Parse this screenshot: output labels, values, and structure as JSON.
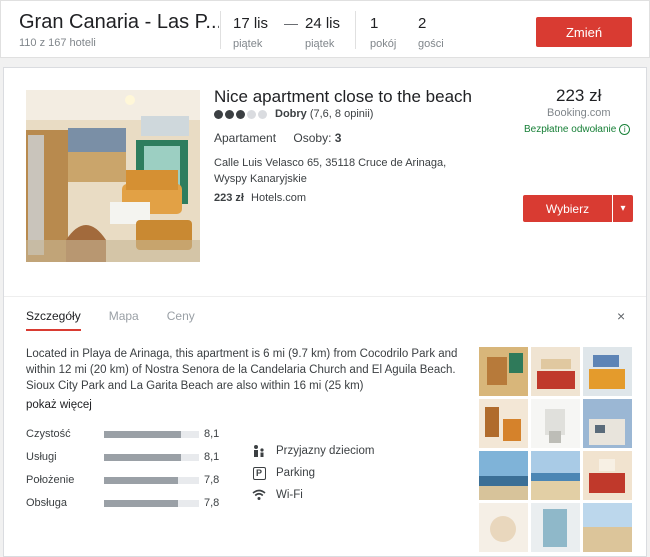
{
  "topbar": {
    "destination": "Gran Canaria - Las P...",
    "hotel_count": "110 z 167 hoteli",
    "checkin_date": "17 lis",
    "checkin_day": "piątek",
    "dash": "—",
    "checkout_date": "24 lis",
    "checkout_day": "piątek",
    "rooms_value": "1",
    "rooms_label": "pokój",
    "guests_value": "2",
    "guests_label": "gości",
    "change_button": "Zmień"
  },
  "listing": {
    "name": "Nice apartment close to the beach",
    "rating_dots": 3,
    "rating_label": "Dobry",
    "rating_score": "(7,6, 8 opinii)",
    "type": "Apartament",
    "guests_label": "Osoby:",
    "guests_value": "3",
    "address": "Calle Luis Velasco 65, 35118 Cruce de Arinaga, Wyspy Kanaryjskie",
    "offer_price": "223 zł",
    "offer_source": "Hotels.com",
    "price": "223 zł",
    "price_source": "Booking.com",
    "free_cancel": "Bezpłatne odwołanie",
    "select_button": "Wybierz",
    "dropdown_icon": "chevron-down-icon"
  },
  "tabs": [
    {
      "label": "Szczegóły",
      "active": true
    },
    {
      "label": "Mapa",
      "active": false
    },
    {
      "label": "Ceny",
      "active": false
    }
  ],
  "close_icon": "×",
  "description": "Located in Playa de Arinaga, this apartment is 6 mi (9.7 km) from Cocodrilo Park and within 12 mi (20 km) of Nostra Senora de la Candelaria Church and El Aguila Beach. Sioux City Park and La Garita Beach are also within 16 mi (25 km)",
  "more_link": "pokaż więcej",
  "ratings": [
    {
      "label": "Czystość",
      "value": "8,1",
      "fraction": 0.81
    },
    {
      "label": "Usługi",
      "value": "8,1",
      "fraction": 0.81
    },
    {
      "label": "Położenie",
      "value": "7,8",
      "fraction": 0.78
    },
    {
      "label": "Obsługa",
      "value": "7,8",
      "fraction": 0.78
    }
  ],
  "amenities": [
    {
      "label": "Przyjazny dzieciom",
      "icon": "family-icon"
    },
    {
      "label": "Parking",
      "icon": "parking-icon"
    },
    {
      "label": "Wi-Fi",
      "icon": "wifi-icon"
    }
  ],
  "colors": {
    "accent": "#d93b32",
    "green": "#188038"
  }
}
